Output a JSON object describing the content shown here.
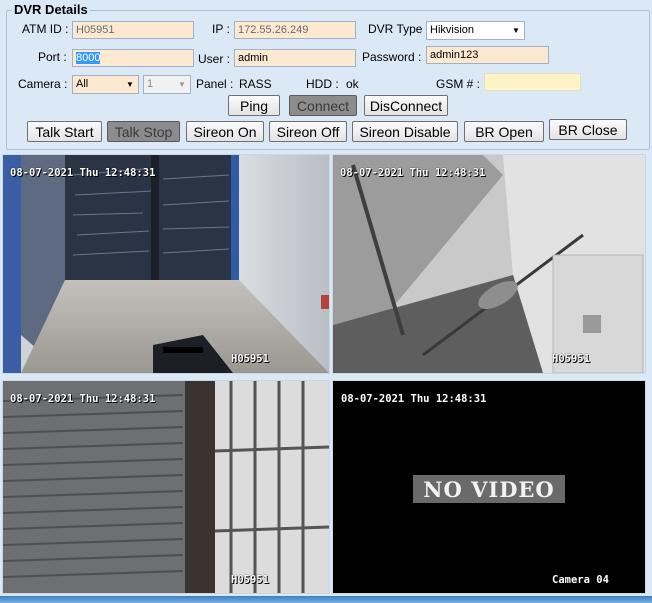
{
  "panel": {
    "title": "DVR Details",
    "atm_id_label": "ATM ID :",
    "atm_id_value": "H05951",
    "ip_label": "IP :",
    "ip_value": "172.55.26.249",
    "dvr_type_label": "DVR Type :",
    "dvr_type_value": "Hikvision",
    "port_label": "Port :",
    "port_value": "8000",
    "user_label": "User :",
    "user_value": "admin",
    "password_label": "Password :",
    "password_value": "admin123",
    "camera_label": "Camera :",
    "camera_value": "All",
    "camera_num_value": "1",
    "panel_label": "Panel :",
    "panel_value": "RASS",
    "hdd_label": "HDD :",
    "hdd_value": "ok",
    "gsm_label": "GSM # :",
    "gsm_value": ""
  },
  "buttons": {
    "ping": "Ping",
    "connect": "Connect",
    "disconnect": "DisConnect",
    "talk_start": "Talk Start",
    "talk_stop": "Talk Stop",
    "sireon_on": "Sireon On",
    "sireon_off": "Sireon Off",
    "sireon_disable": "Sireon Disable",
    "br_open": "BR Open",
    "br_close": "BR Close"
  },
  "cameras": [
    {
      "timestamp": "08-07-2021 Thu 12:48:31",
      "label": "H05951"
    },
    {
      "timestamp": "08-07-2021 Thu 12:48:31",
      "label": "H05951"
    },
    {
      "timestamp": "08-07-2021 Thu 12:48:31",
      "label": "H05951"
    },
    {
      "timestamp": "08-07-2021 Thu 12:48:31",
      "label": "Camera 04",
      "overlay": "NO VIDEO"
    }
  ],
  "colors": {
    "window_bg": "#dbe8f6",
    "field_bg": "#fde9d2",
    "gsm_bg": "#fdf3c6",
    "pressed_button": "#8c8c8c"
  },
  "icons": [
    "dropdown-arrow-icon"
  ]
}
